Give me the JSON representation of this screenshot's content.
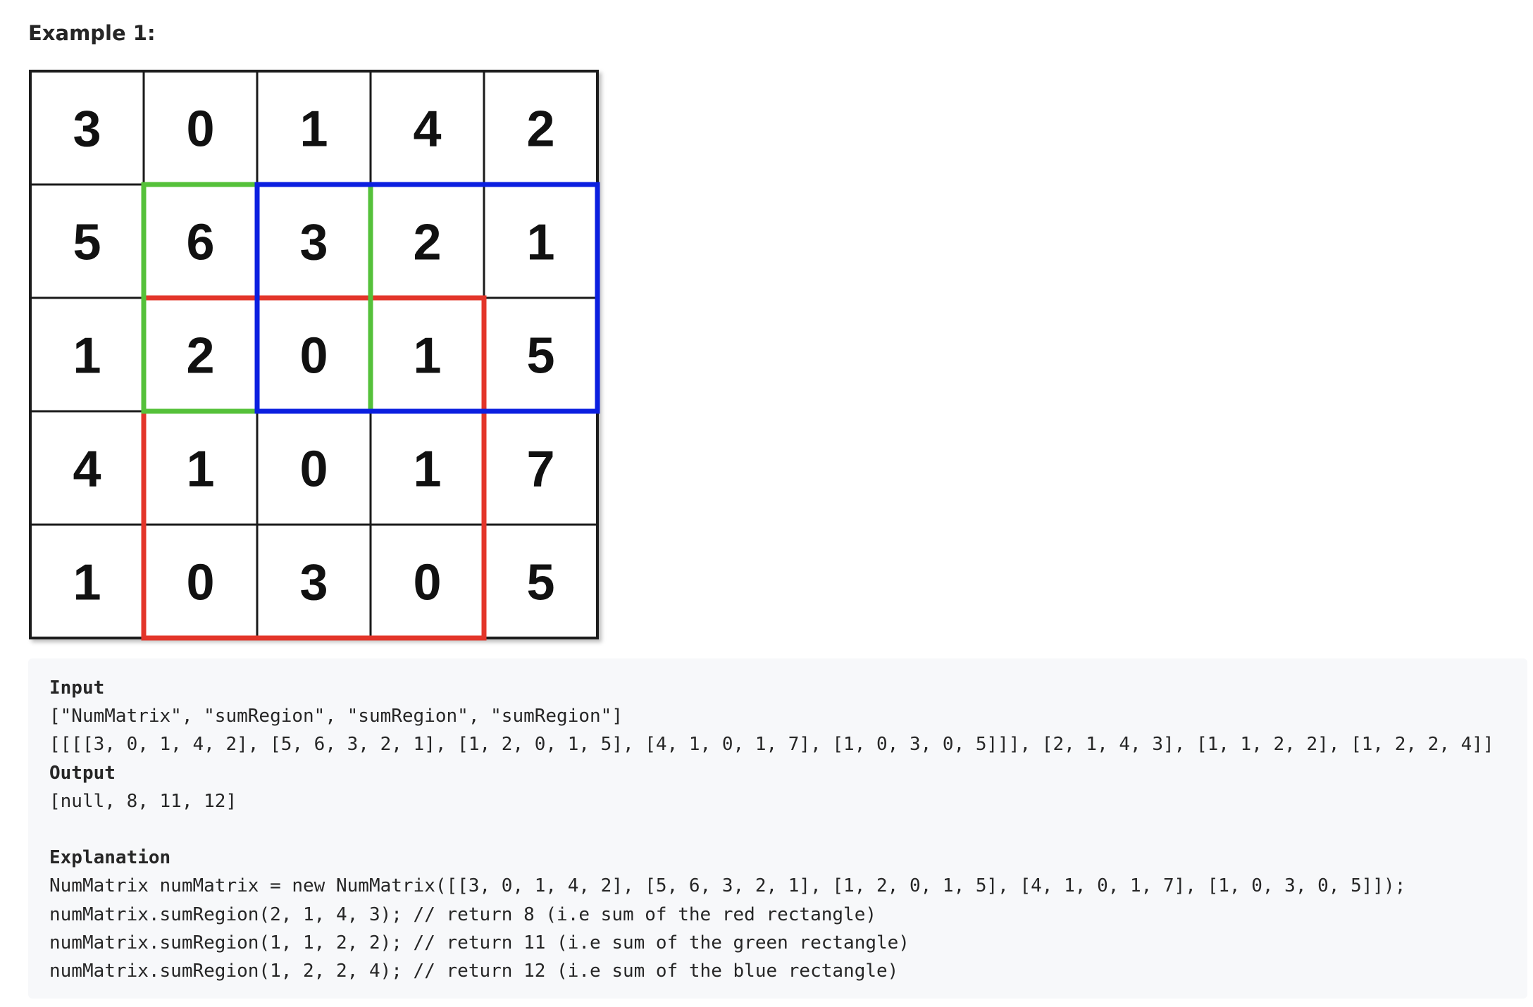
{
  "heading": "Example 1:",
  "matrix": [
    [
      "3",
      "0",
      "1",
      "4",
      "2"
    ],
    [
      "5",
      "6",
      "3",
      "2",
      "1"
    ],
    [
      "1",
      "2",
      "0",
      "1",
      "5"
    ],
    [
      "4",
      "1",
      "0",
      "1",
      "7"
    ],
    [
      "1",
      "0",
      "3",
      "0",
      "5"
    ]
  ],
  "highlights": [
    {
      "row1": 2,
      "col1": 1,
      "row2": 4,
      "col2": 3,
      "color": "#e3352a"
    },
    {
      "row1": 1,
      "col1": 1,
      "row2": 2,
      "col2": 2,
      "color": "#55c13a"
    },
    {
      "row1": 1,
      "col1": 2,
      "row2": 2,
      "col2": 4,
      "color": "#0b1fe0"
    }
  ],
  "code": {
    "input_label": "Input",
    "input_line1": "[\"NumMatrix\", \"sumRegion\", \"sumRegion\", \"sumRegion\"]",
    "input_line2": "[[[[3, 0, 1, 4, 2], [5, 6, 3, 2, 1], [1, 2, 0, 1, 5], [4, 1, 0, 1, 7], [1, 0, 3, 0, 5]]], [2, 1, 4, 3], [1, 1, 2, 2], [1, 2, 2, 4]]",
    "output_label": "Output",
    "output_line": "[null, 8, 11, 12]",
    "explanation_label": "Explanation",
    "explanation_lines": [
      "NumMatrix numMatrix = new NumMatrix([[3, 0, 1, 4, 2], [5, 6, 3, 2, 1], [1, 2, 0, 1, 5], [4, 1, 0, 1, 7], [1, 0, 3, 0, 5]]);",
      "numMatrix.sumRegion(2, 1, 4, 3); // return 8 (i.e sum of the red rectangle)",
      "numMatrix.sumRegion(1, 1, 2, 2); // return 11 (i.e sum of the green rectangle)",
      "numMatrix.sumRegion(1, 2, 2, 4); // return 12 (i.e sum of the blue rectangle)"
    ]
  }
}
